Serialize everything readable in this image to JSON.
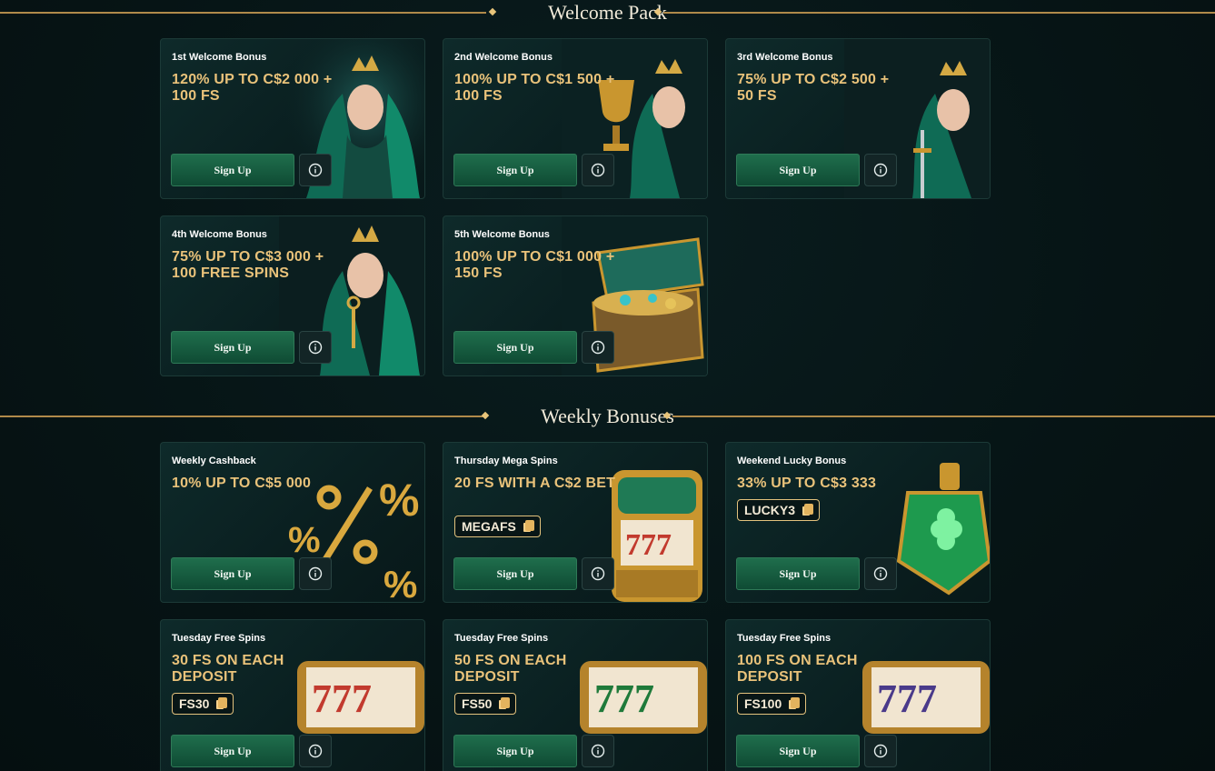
{
  "sections": {
    "welcome_title": "Welcome Pack",
    "weekly_title": "Weekly Bonuses"
  },
  "welcome_cards": [
    {
      "kicker": "1st Welcome Bonus",
      "headline": "120% UP TO C$2 000 + 100 FS",
      "button": "Sign Up",
      "art": "elf-queen-icon"
    },
    {
      "kicker": "2nd Welcome Bonus",
      "headline": "100% UP TO C$1 500 + 100 FS",
      "button": "Sign Up",
      "art": "elf-queen-trophy-icon"
    },
    {
      "kicker": "3rd Welcome Bonus",
      "headline": "75% UP TO C$2 500 + 50 FS",
      "button": "Sign Up",
      "art": "elf-queen-sword-icon"
    },
    {
      "kicker": "4th Welcome Bonus",
      "headline": "75% UP TO C$3 000 + 100 FREE SPINS",
      "button": "Sign Up",
      "art": "elf-queen-key-icon"
    },
    {
      "kicker": "5th Welcome Bonus",
      "headline": "100% UP TO C$1 000 + 150 FS",
      "button": "Sign Up",
      "art": "treasure-chest-icon"
    }
  ],
  "weekly_cards": [
    {
      "kicker": "Weekly Cashback",
      "headline": "10% UP TO C$5 000",
      "button": "Sign Up",
      "art": "gold-percent-icon"
    },
    {
      "kicker": "Thursday Mega Spins",
      "headline": "20 FS WITH A C$2 BET",
      "code": "MEGAFS",
      "button": "Sign Up",
      "art": "slot-machine-icon"
    },
    {
      "kicker": "Weekend Lucky Bonus",
      "headline": "33% UP TO C$3 333",
      "code": "LUCKY3",
      "button": "Sign Up",
      "art": "clover-potion-icon"
    },
    {
      "kicker": "Tuesday Free Spins",
      "headline": "30 FS ON EACH DEPOSIT",
      "code": "FS30",
      "button": "Sign Up",
      "art": "red-sevens-reel-icon"
    },
    {
      "kicker": "Tuesday Free Spins",
      "headline": "50 FS ON EACH DEPOSIT",
      "code": "FS50",
      "button": "Sign Up",
      "art": "green-sevens-reel-icon"
    },
    {
      "kicker": "Tuesday Free Spins",
      "headline": "100 FS ON EACH DEPOSIT",
      "code": "FS100",
      "button": "Sign Up",
      "art": "purple-sevens-reel-icon"
    }
  ],
  "colors": {
    "background": "#061516",
    "gold_accent": "#e9c27a",
    "button_green": "#1f6e4c",
    "card_border": "#1c3a37"
  }
}
